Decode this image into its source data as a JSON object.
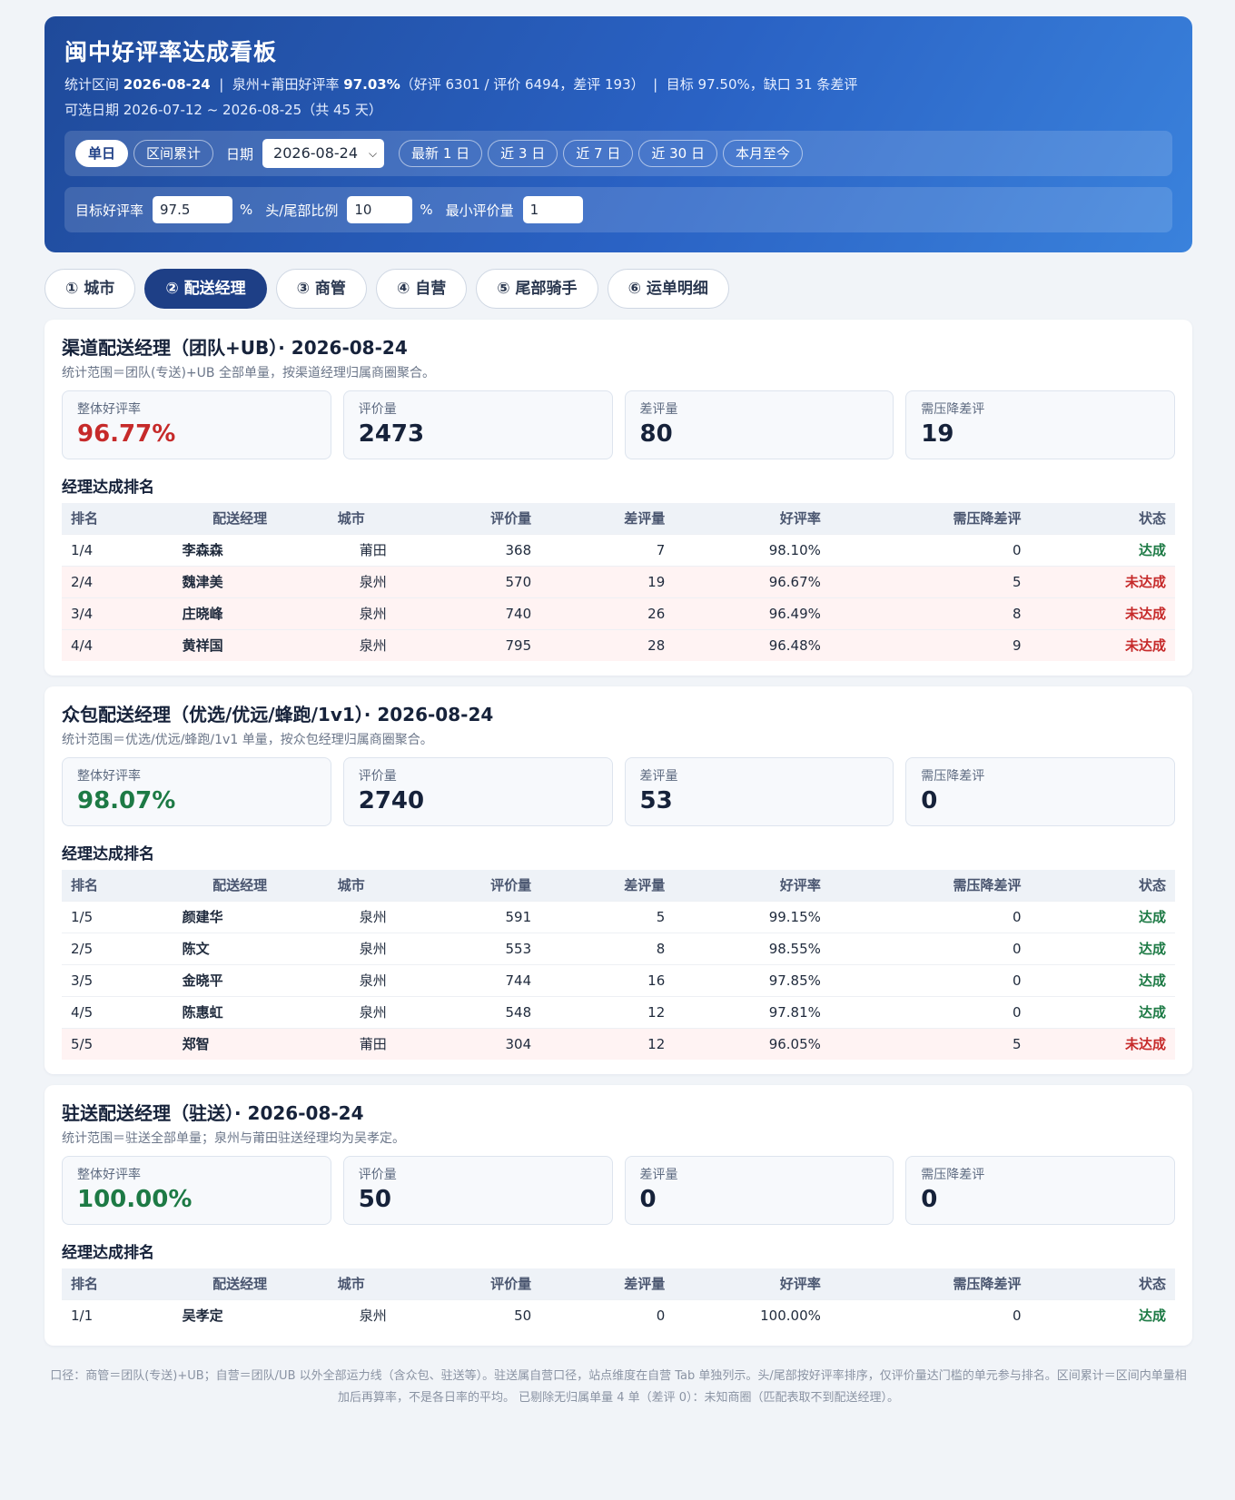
{
  "header": {
    "title": "闽中好评率达成看板",
    "line1_prefix": "统计区间",
    "line1_date": "2026-08-24",
    "line1_sep1": "|",
    "line1_scope": "泉州+莆田好评率",
    "line1_rate": "97.03%",
    "line1_detail": "（好评 6301 / 评价 6494，差评 193）",
    "line1_sep2": "|",
    "line1_target": "目标 97.50%，缺口 31 条差评",
    "line2": "可选日期 2026-07-12 ~ 2026-08-25（共 45 天）"
  },
  "controls": {
    "mode_single": "单日",
    "mode_range": "区间累计",
    "date_label": "日期",
    "date_value": "2026-08-24",
    "quick": [
      "最新 1 日",
      "近 3 日",
      "近 7 日",
      "近 30 日",
      "本月至今"
    ],
    "target_label": "目标好评率",
    "target_value": "97.5",
    "pct1": "%",
    "ratio_label": "头/尾部比例",
    "ratio_value": "10",
    "pct2": "%",
    "min_label": "最小评价量",
    "min_value": "1"
  },
  "tabs": [
    "① 城市",
    "② 配送经理",
    "③ 商管",
    "④ 自营",
    "⑤ 尾部骑手",
    "⑥ 运单明细"
  ],
  "columns": [
    "排名",
    "配送经理",
    "城市",
    "评价量",
    "差评量",
    "好评率",
    "需压降差评",
    "状态"
  ],
  "kpi_labels": [
    "整体好评率",
    "评价量",
    "差评量",
    "需压降差评"
  ],
  "rank_title": "经理达成排名",
  "sections": [
    {
      "title": "渠道配送经理（团队+UB）· 2026-08-24",
      "scope": "统计范围＝团队(专送)+UB 全部单量，按渠道经理归属商圈聚合。",
      "kpi": [
        "96.77%",
        "2473",
        "80",
        "19"
      ],
      "rate_color": "red",
      "rows": [
        {
          "rank": "1/4",
          "name": "李森森",
          "city": "莆田",
          "reviews": "368",
          "bad": "7",
          "rate": "98.10%",
          "need": "0",
          "status": "达成",
          "ok": true
        },
        {
          "rank": "2/4",
          "name": "魏津美",
          "city": "泉州",
          "reviews": "570",
          "bad": "19",
          "rate": "96.67%",
          "need": "5",
          "status": "未达成",
          "ok": false
        },
        {
          "rank": "3/4",
          "name": "庄晓峰",
          "city": "泉州",
          "reviews": "740",
          "bad": "26",
          "rate": "96.49%",
          "need": "8",
          "status": "未达成",
          "ok": false
        },
        {
          "rank": "4/4",
          "name": "黄祥国",
          "city": "泉州",
          "reviews": "795",
          "bad": "28",
          "rate": "96.48%",
          "need": "9",
          "status": "未达成",
          "ok": false
        }
      ]
    },
    {
      "title": "众包配送经理（优选/优远/蜂跑/1v1）· 2026-08-24",
      "scope": "统计范围＝优选/优远/蜂跑/1v1 单量，按众包经理归属商圈聚合。",
      "kpi": [
        "98.07%",
        "2740",
        "53",
        "0"
      ],
      "rate_color": "green",
      "rows": [
        {
          "rank": "1/5",
          "name": "颜建华",
          "city": "泉州",
          "reviews": "591",
          "bad": "5",
          "rate": "99.15%",
          "need": "0",
          "status": "达成",
          "ok": true
        },
        {
          "rank": "2/5",
          "name": "陈文",
          "city": "泉州",
          "reviews": "553",
          "bad": "8",
          "rate": "98.55%",
          "need": "0",
          "status": "达成",
          "ok": true
        },
        {
          "rank": "3/5",
          "name": "金晓平",
          "city": "泉州",
          "reviews": "744",
          "bad": "16",
          "rate": "97.85%",
          "need": "0",
          "status": "达成",
          "ok": true
        },
        {
          "rank": "4/5",
          "name": "陈惠虹",
          "city": "泉州",
          "reviews": "548",
          "bad": "12",
          "rate": "97.81%",
          "need": "0",
          "status": "达成",
          "ok": true
        },
        {
          "rank": "5/5",
          "name": "郑智",
          "city": "莆田",
          "reviews": "304",
          "bad": "12",
          "rate": "96.05%",
          "need": "5",
          "status": "未达成",
          "ok": false
        }
      ]
    },
    {
      "title": "驻送配送经理（驻送）· 2026-08-24",
      "scope": "统计范围＝驻送全部单量；泉州与莆田驻送经理均为吴孝定。",
      "kpi": [
        "100.00%",
        "50",
        "0",
        "0"
      ],
      "rate_color": "green",
      "rows": [
        {
          "rank": "1/1",
          "name": "吴孝定",
          "city": "泉州",
          "reviews": "50",
          "bad": "0",
          "rate": "100.00%",
          "need": "0",
          "status": "达成",
          "ok": true
        }
      ]
    }
  ],
  "footer": "口径：商管＝团队(专送)+UB；自营＝团队/UB 以外全部运力线（含众包、驻送等）。驻送属自营口径，站点维度在自营 Tab 单独列示。头/尾部按好评率排序，仅评价量达门槛的单元参与排名。区间累计＝区间内单量相加后再算率，不是各日率的平均。 已剔除无归属单量 4 单（差评 0）：未知商圈（匹配表取不到配送经理）。",
  "colors": {
    "brand": "#1e3f86",
    "ok": "#1d7a45",
    "bad": "#c62a2a"
  }
}
